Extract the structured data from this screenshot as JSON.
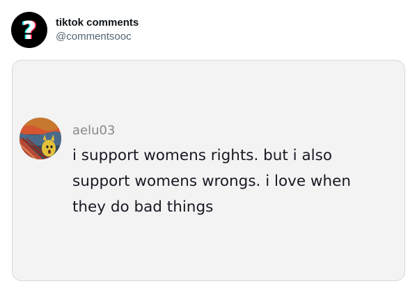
{
  "post": {
    "display_name": "tiktok comments",
    "handle": "@commentsooc",
    "avatar_icon": "question-mark-icon"
  },
  "comment": {
    "username": "aelu03",
    "text": "i support womens rights. but i also support womens wrongs. i love when they do bad things",
    "avatar": "painting-avatar"
  },
  "colors": {
    "card_background": "#f4f3f3",
    "username_gray": "#888888",
    "comment_text": "#161823"
  }
}
